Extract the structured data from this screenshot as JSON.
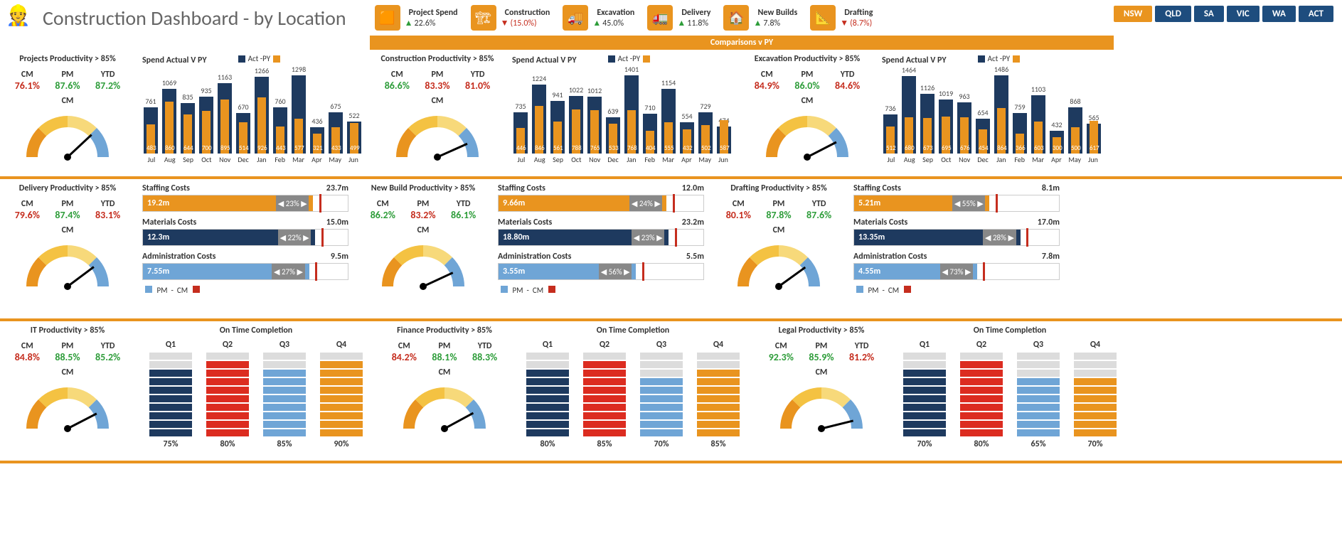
{
  "header": {
    "title": "Construction Dashboard - by Location",
    "comparisons_label": "Comparisons v PY",
    "kpis": [
      {
        "label": "Project Spend",
        "value": "22.6%",
        "dir": "up"
      },
      {
        "label": "Construction",
        "value": "(15.0%)",
        "dir": "down"
      },
      {
        "label": "Excavation",
        "value": "45.0%",
        "dir": "up"
      },
      {
        "label": "Delivery",
        "value": "11.8%",
        "dir": "up"
      },
      {
        "label": "New Builds",
        "value": "7.8%",
        "dir": "up"
      },
      {
        "label": "Drafting",
        "value": "(8.7%)",
        "dir": "down"
      }
    ],
    "locations": [
      "NSW",
      "QLD",
      "SA",
      "VIC",
      "WA",
      "ACT"
    ],
    "active_location": "NSW"
  },
  "row1": [
    {
      "prod": {
        "title": "Projects Productivity > 85%",
        "cm": "76.1%",
        "cm_cls": "red",
        "pm": "87.6%",
        "pm_cls": "green",
        "ytd": "87.2%",
        "ytd_cls": "green",
        "gauge_lbl": "CM",
        "gauge": 0.761
      },
      "bar": {
        "title": "Spend Actual V PY",
        "leg_a": "Act",
        "leg_b": "PY",
        "categories": [
          "Jul",
          "Aug",
          "Sep",
          "Oct",
          "Nov",
          "Dec",
          "Jan",
          "Feb",
          "Mar",
          "Apr",
          "May",
          "Jun"
        ],
        "actual": [
          761,
          1069,
          835,
          935,
          1163,
          670,
          1266,
          760,
          1298,
          436,
          675,
          522
        ],
        "py": [
          483,
          860,
          644,
          700,
          895,
          514,
          926,
          443,
          577,
          321,
          433,
          499
        ]
      }
    },
    {
      "prod": {
        "title": "Construction Productivity > 85%",
        "cm": "86.6%",
        "cm_cls": "green",
        "pm": "83.3%",
        "pm_cls": "red",
        "ytd": "81.0%",
        "ytd_cls": "red",
        "gauge_lbl": "CM",
        "gauge": 0.866
      },
      "bar": {
        "title": "Spend Actual V PY",
        "leg_a": "Act",
        "leg_b": "PY",
        "categories": [
          "Jul",
          "Aug",
          "Sep",
          "Oct",
          "Nov",
          "Dec",
          "Jan",
          "Feb",
          "Mar",
          "Apr",
          "May",
          "Jun"
        ],
        "actual": [
          735,
          1224,
          941,
          1022,
          1012,
          639,
          1401,
          710,
          1154,
          554,
          729,
          474
        ],
        "py": [
          446,
          846,
          561,
          788,
          765,
          533,
          768,
          404,
          555,
          432,
          502,
          587
        ]
      }
    },
    {
      "prod": {
        "title": "Excavation Productivity > 85%",
        "cm": "84.9%",
        "cm_cls": "red",
        "pm": "86.0%",
        "pm_cls": "green",
        "ytd": "84.6%",
        "ytd_cls": "red",
        "gauge_lbl": "CM",
        "gauge": 0.849
      },
      "bar": {
        "title": "Spend Actual V PY",
        "leg_a": "Act",
        "leg_b": "PY",
        "categories": [
          "Jul",
          "Aug",
          "Sep",
          "Oct",
          "Nov",
          "Dec",
          "Jan",
          "Feb",
          "Mar",
          "Apr",
          "May",
          "Jun"
        ],
        "actual": [
          736,
          1464,
          1126,
          1019,
          963,
          654,
          1486,
          759,
          1103,
          432,
          868,
          565
        ],
        "py": [
          512,
          680,
          673,
          695,
          676,
          454,
          864,
          366,
          603,
          300,
          500,
          617
        ]
      }
    }
  ],
  "row2": [
    {
      "prod": {
        "title": "Delivery Productivity > 85%",
        "cm": "79.6%",
        "cm_cls": "red",
        "pm": "87.4%",
        "pm_cls": "green",
        "ytd": "83.1%",
        "ytd_cls": "red",
        "gauge_lbl": "CM",
        "gauge": 0.796
      },
      "costs": {
        "legend": "PM  -  CM",
        "items": [
          {
            "name": "Staffing Costs",
            "target": "23.7m",
            "value": "19.2m",
            "color": "#e9941f",
            "fill": 0.81,
            "delta": "23%"
          },
          {
            "name": "Materials Costs",
            "target": "15.0m",
            "value": "12.3m",
            "color": "#1e3a5f",
            "fill": 0.82,
            "delta": "22%"
          },
          {
            "name": "Administration Costs",
            "target": "9.5m",
            "value": "7.55m",
            "color": "#6fa5d6",
            "fill": 0.79,
            "delta": "27%"
          }
        ]
      }
    },
    {
      "prod": {
        "title": "New Build Productivity > 85%",
        "cm": "86.2%",
        "cm_cls": "green",
        "pm": "83.2%",
        "pm_cls": "red",
        "ytd": "86.1%",
        "ytd_cls": "green",
        "gauge_lbl": "CM",
        "gauge": 0.862
      },
      "costs": {
        "legend": "PM  -  CM",
        "items": [
          {
            "name": "Staffing Costs",
            "target": "12.0m",
            "value": "9.66m",
            "color": "#e9941f",
            "fill": 0.8,
            "delta": "24%"
          },
          {
            "name": "Materials Costs",
            "target": "23.2m",
            "value": "18.80m",
            "color": "#1e3a5f",
            "fill": 0.81,
            "delta": "23%"
          },
          {
            "name": "Administration Costs",
            "target": "5.5m",
            "value": "3.55m",
            "color": "#6fa5d6",
            "fill": 0.65,
            "delta": "56%"
          }
        ]
      }
    },
    {
      "prod": {
        "title": "Drafting Productivity > 85%",
        "cm": "80.1%",
        "cm_cls": "red",
        "pm": "87.8%",
        "pm_cls": "green",
        "ytd": "87.6%",
        "ytd_cls": "green",
        "gauge_lbl": "CM",
        "gauge": 0.801
      },
      "costs": {
        "legend": "PM  -  CM",
        "items": [
          {
            "name": "Staffing Costs",
            "target": "8.1m",
            "value": "5.21m",
            "color": "#e9941f",
            "fill": 0.64,
            "delta": "55%"
          },
          {
            "name": "Materials Costs",
            "target": "17.0m",
            "value": "13.35m",
            "color": "#1e3a5f",
            "fill": 0.79,
            "delta": "28%"
          },
          {
            "name": "Administration Costs",
            "target": "7.8m",
            "value": "4.55m",
            "color": "#6fa5d6",
            "fill": 0.58,
            "delta": "73%"
          }
        ]
      }
    }
  ],
  "row3": [
    {
      "prod": {
        "title": "IT Productivity > 85%",
        "cm": "84.8%",
        "cm_cls": "red",
        "pm": "88.5%",
        "pm_cls": "green",
        "ytd": "85.2%",
        "ytd_cls": "green",
        "gauge_lbl": "CM",
        "gauge": 0.848
      },
      "otc": {
        "title": "On Time Completion",
        "cols": [
          {
            "q": "Q1",
            "pct": "75%",
            "fill": 8,
            "color": "navy"
          },
          {
            "q": "Q2",
            "pct": "80%",
            "fill": 9,
            "color": "red"
          },
          {
            "q": "Q3",
            "pct": "85%",
            "fill": 8,
            "color": "blue"
          },
          {
            "q": "Q4",
            "pct": "90%",
            "fill": 9,
            "color": "orange"
          }
        ]
      }
    },
    {
      "prod": {
        "title": "Finance Productivity > 85%",
        "cm": "84.2%",
        "cm_cls": "red",
        "pm": "88.1%",
        "pm_cls": "green",
        "ytd": "88.3%",
        "ytd_cls": "green",
        "gauge_lbl": "CM",
        "gauge": 0.842
      },
      "otc": {
        "title": "On Time Completion",
        "cols": [
          {
            "q": "Q1",
            "pct": "80%",
            "fill": 8,
            "color": "navy"
          },
          {
            "q": "Q2",
            "pct": "85%",
            "fill": 9,
            "color": "red"
          },
          {
            "q": "Q3",
            "pct": "70%",
            "fill": 7,
            "color": "blue"
          },
          {
            "q": "Q4",
            "pct": "85%",
            "fill": 8,
            "color": "orange"
          }
        ]
      }
    },
    {
      "prod": {
        "title": "Legal Productivity > 85%",
        "cm": "92.3%",
        "cm_cls": "green",
        "pm": "85.9%",
        "pm_cls": "green",
        "ytd": "81.2%",
        "ytd_cls": "red",
        "gauge_lbl": "CM",
        "gauge": 0.923
      },
      "otc": {
        "title": "On Time Completion",
        "cols": [
          {
            "q": "Q1",
            "pct": "70%",
            "fill": 8,
            "color": "navy"
          },
          {
            "q": "Q2",
            "pct": "80%",
            "fill": 9,
            "color": "red"
          },
          {
            "q": "Q3",
            "pct": "65%",
            "fill": 7,
            "color": "blue"
          },
          {
            "q": "Q4",
            "pct": "70%",
            "fill": 7,
            "color": "orange"
          }
        ]
      }
    }
  ],
  "chart_data": [
    {
      "type": "bar",
      "title": "Projects – Spend Actual V PY",
      "categories": [
        "Jul",
        "Aug",
        "Sep",
        "Oct",
        "Nov",
        "Dec",
        "Jan",
        "Feb",
        "Mar",
        "Apr",
        "May",
        "Jun"
      ],
      "series": [
        {
          "name": "Act",
          "values": [
            761,
            1069,
            835,
            935,
            1163,
            670,
            1266,
            760,
            1298,
            436,
            675,
            522
          ]
        },
        {
          "name": "PY",
          "values": [
            483,
            860,
            644,
            700,
            895,
            514,
            926,
            443,
            577,
            321,
            433,
            499
          ]
        }
      ]
    },
    {
      "type": "bar",
      "title": "Construction – Spend Actual V PY",
      "categories": [
        "Jul",
        "Aug",
        "Sep",
        "Oct",
        "Nov",
        "Dec",
        "Jan",
        "Feb",
        "Mar",
        "Apr",
        "May",
        "Jun"
      ],
      "series": [
        {
          "name": "Act",
          "values": [
            735,
            1224,
            941,
            1022,
            1012,
            639,
            1401,
            710,
            1154,
            554,
            729,
            474
          ]
        },
        {
          "name": "PY",
          "values": [
            446,
            846,
            561,
            788,
            765,
            533,
            768,
            404,
            555,
            432,
            502,
            587
          ]
        }
      ]
    },
    {
      "type": "bar",
      "title": "Excavation – Spend Actual V PY",
      "categories": [
        "Jul",
        "Aug",
        "Sep",
        "Oct",
        "Nov",
        "Dec",
        "Jan",
        "Feb",
        "Mar",
        "Apr",
        "May",
        "Jun"
      ],
      "series": [
        {
          "name": "Act",
          "values": [
            736,
            1464,
            1126,
            1019,
            963,
            654,
            1486,
            759,
            1103,
            432,
            868,
            565
          ]
        },
        {
          "name": "PY",
          "values": [
            512,
            680,
            673,
            695,
            676,
            454,
            864,
            366,
            603,
            300,
            500,
            617
          ]
        }
      ]
    }
  ]
}
